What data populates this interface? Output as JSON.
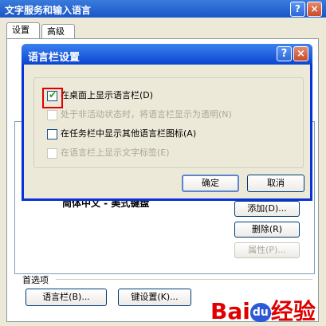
{
  "window": {
    "title": "文字服务和输入语言",
    "help": "?",
    "close": "×"
  },
  "tabs": [
    "设置",
    "高级"
  ],
  "main": {
    "service": "简体中文 - 美式键盘",
    "buttons": {
      "add": "添加(D)...",
      "remove": "删除(R)",
      "properties": "属性(P)..."
    },
    "prefs_label": "首选项",
    "prefs_buttons": {
      "language_bar": "语言栏(B)...",
      "key_settings": "键设置(K)..."
    }
  },
  "dialog": {
    "title": "语言栏设置",
    "help": "?",
    "close": "×",
    "options": [
      {
        "label": "在桌面上显示语言栏(D)",
        "checked": true,
        "disabled": false
      },
      {
        "label": "处于非活动状态时，将语言栏显示为透明(N)",
        "checked": false,
        "disabled": true
      },
      {
        "label": "在任务栏中显示其他语言栏图标(A)",
        "checked": false,
        "disabled": false
      },
      {
        "label": "在语言栏上显示文字标签(E)",
        "checked": false,
        "disabled": true
      }
    ],
    "ok": "确定",
    "cancel": "取消"
  },
  "watermark": {
    "brand_a": "Bai",
    "brand_b": "du",
    "brand_c": "经验"
  },
  "colors": {
    "accent": "#0831d9",
    "highlight": "#e00000",
    "check": "#21a121"
  }
}
